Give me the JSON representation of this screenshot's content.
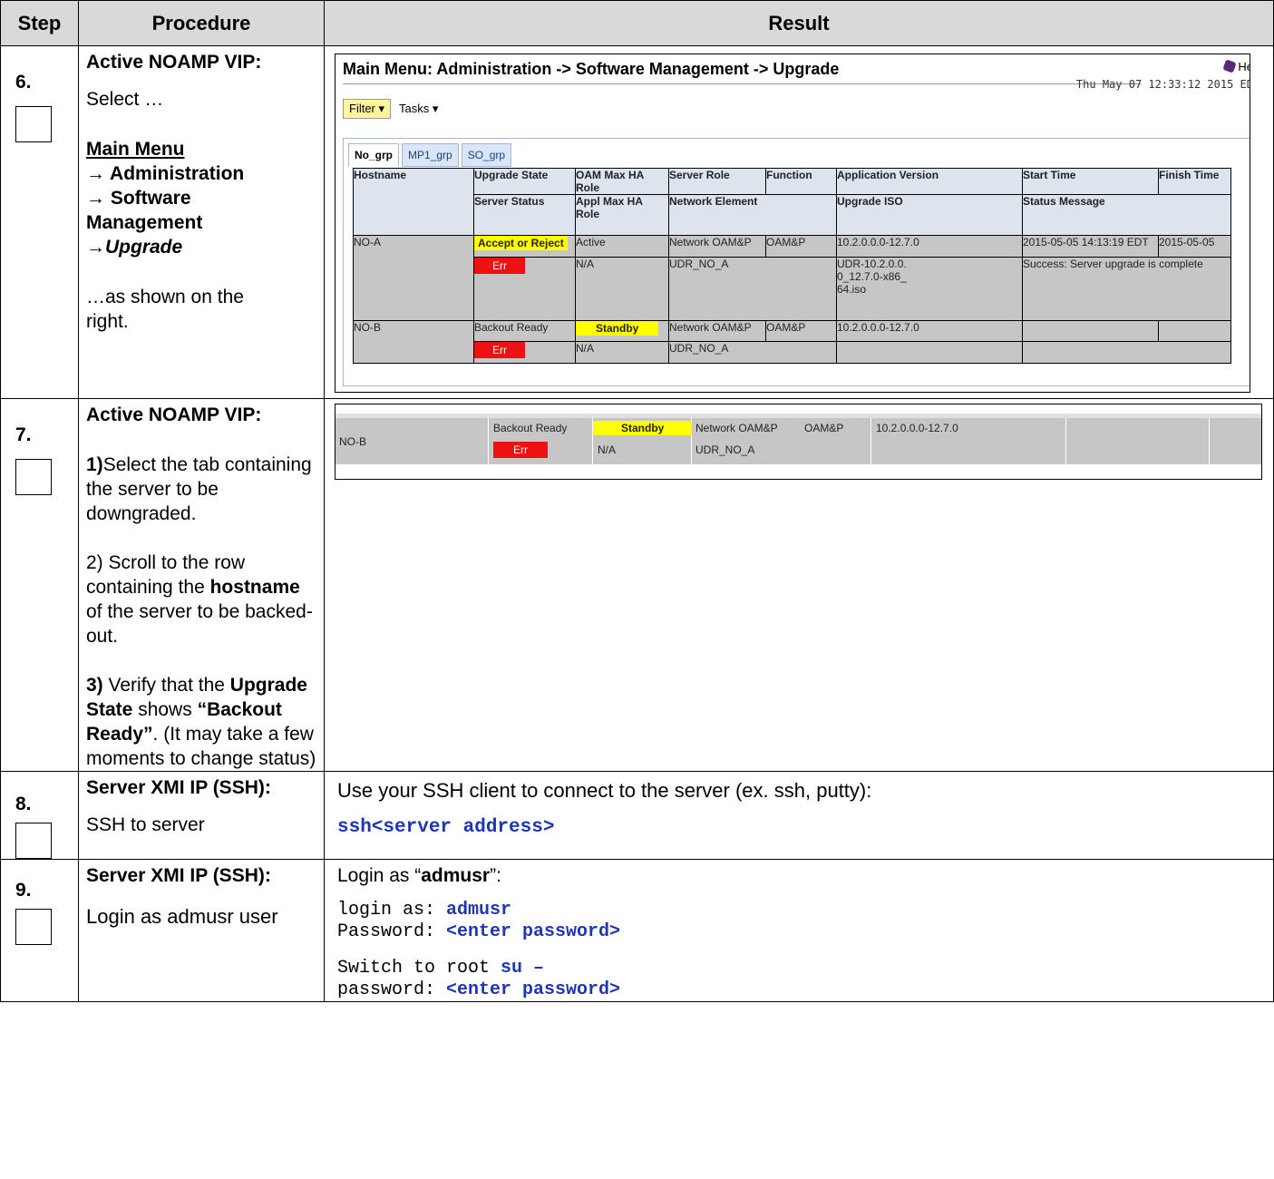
{
  "headers": {
    "step": "Step",
    "procedure": "Procedure",
    "result": "Result"
  },
  "step6": {
    "num": "6.",
    "head": "Active NOAMP VIP:",
    "select": "Select …",
    "menu1": "Main Menu",
    "menu2": "→ Administration",
    "menu3": "→ Software",
    "menu4": "Management",
    "menu5": "→Upgrade",
    "tail1": "…as shown on the",
    "tail2": "right.",
    "screen": {
      "main_menu": "Main Menu: Administration -> Software Management -> Upgrade",
      "help": "He",
      "date": "Thu May 07 12:33:12 2015 ED",
      "filter": "Filter",
      "tasks": "Tasks",
      "tabs": [
        "No_grp",
        "MP1_grp",
        "SO_grp"
      ],
      "hdr1": {
        "upgrade_state": "Upgrade State",
        "oam_max": "OAM Max HA Role",
        "server_role": "Server Role",
        "function": "Function",
        "app_version": "Application Version",
        "start_time": "Start Time",
        "finish_time": "Finish Time"
      },
      "hdr2": {
        "hostname": "Hostname",
        "server_status": "Server Status",
        "appl_max": "Appl Max HA Role",
        "network_element": "Network Element",
        "upgrade_iso": "Upgrade ISO",
        "status_message": "Status Message"
      },
      "rowA": {
        "hostname": "NO-A",
        "state": "Accept or Reject",
        "oam": "Active",
        "role": "Network OAM&P",
        "function": "OAM&P",
        "version": "10.2.0.0.0-12.7.0",
        "start": "2015-05-05 14:13:19 EDT",
        "finish": "2015-05-05",
        "status": "Err",
        "appl": "N/A",
        "ne": "UDR_NO_A",
        "iso": "UDR-10.2.0.0.0_12.7.0-x86_64.iso",
        "message": "Success: Server upgrade is complete"
      },
      "rowB": {
        "hostname": "NO-B",
        "state": "Backout Ready",
        "oam": "Standby",
        "role": "Network OAM&P",
        "function": "OAM&P",
        "version": "10.2.0.0.0-12.7.0",
        "status": "Err",
        "appl": "N/A",
        "ne": "UDR_NO_A"
      }
    }
  },
  "step7": {
    "num": "7.",
    "head": "Active NOAMP VIP:",
    "p1_num": "1)",
    "p1": "Select the tab containing the server to be downgraded.",
    "p2_a": "2) Scroll to the row containing the ",
    "p2_b": "hostname",
    "p2_c": " of the server to be backed-out.",
    "p3_num": "3)",
    "p3_a": " Verify that the ",
    "p3_b": "Upgrade State",
    "p3_c": " shows ",
    "p3_d": "“Backout Ready”",
    "p3_e": ". (It may take a few moments to change status)",
    "screen": {
      "hostname": "NO-B",
      "state": "Backout Ready",
      "oam": "Standby",
      "role": "Network OAM&P",
      "function": "OAM&P",
      "version": "10.2.0.0.0-12.7.0",
      "status": "Err",
      "appl": "N/A",
      "ne": "UDR_NO_A"
    }
  },
  "step8": {
    "num": "8.",
    "head": "Server XMI IP (SSH):",
    "desc": "SSH to server",
    "result_text": "Use your SSH client to connect to the server (ex. ssh, putty):",
    "cmd": "ssh<server address>"
  },
  "step9": {
    "num": "9.",
    "head": "Server XMI IP (SSH):",
    "desc": "Login as admusr user",
    "login_a": "Login as “",
    "login_b": "admusr",
    "login_c": "”:",
    "l1_a": "login as: ",
    "l1_b": "admusr",
    "l2_a": "Password: ",
    "l2_b": "<enter password>",
    "l3_a": "Switch to root ",
    "l3_b": "su –",
    "l4_a": "password: ",
    "l4_b": "<enter password>"
  }
}
